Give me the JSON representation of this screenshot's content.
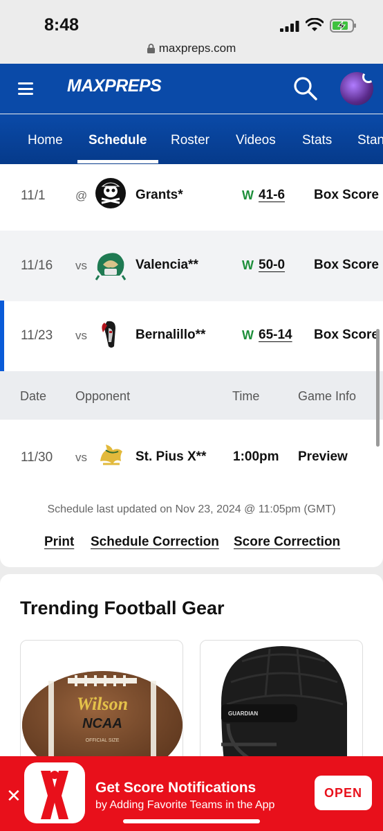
{
  "status_bar": {
    "time": "8:48",
    "url": "maxpreps.com"
  },
  "header": {
    "logo": "MAXPREPS"
  },
  "tabs": [
    {
      "label": "Home"
    },
    {
      "label": "Schedule"
    },
    {
      "label": "Roster"
    },
    {
      "label": "Videos"
    },
    {
      "label": "Stats"
    },
    {
      "label": "Stan"
    }
  ],
  "games_played": [
    {
      "date": "11/1",
      "vs": "@",
      "opponent": "Grants*",
      "result": "W",
      "score": "41-6",
      "info": "Box Score"
    },
    {
      "date": "11/16",
      "vs": "vs",
      "opponent": "Valencia**",
      "result": "W",
      "score": "50-0",
      "info": "Box Score"
    },
    {
      "date": "11/23",
      "vs": "vs",
      "opponent": "Bernalillo**",
      "result": "W",
      "score": "65-14",
      "info": "Box Score"
    }
  ],
  "table_header": {
    "date": "Date",
    "opponent": "Opponent",
    "time": "Time",
    "info": "Game Info"
  },
  "upcoming": [
    {
      "date": "11/30",
      "vs": "vs",
      "opponent": "St. Pius X**",
      "time": "1:00pm",
      "info": "Preview"
    }
  ],
  "updated_text": "Schedule last updated on Nov 23, 2024 @ 11:05pm (GMT)",
  "links": {
    "print": "Print",
    "schedule_correction": "Schedule Correction",
    "score_correction": "Score Correction"
  },
  "trending": {
    "title": "Trending Football Gear",
    "ball_brand": "Wilson",
    "ball_label": "NCAA",
    "ball_size": "OFFICIAL SIZE",
    "helmet_brand": "GUARDIAN"
  },
  "banner": {
    "title": "Get Score Notifications",
    "subtitle": "by Adding Favorite Teams in the App",
    "open": "OPEN"
  },
  "colors": {
    "brand_blue": "#0a4aa8",
    "win_green": "#1e8f3b",
    "banner_red": "#e8101b"
  }
}
